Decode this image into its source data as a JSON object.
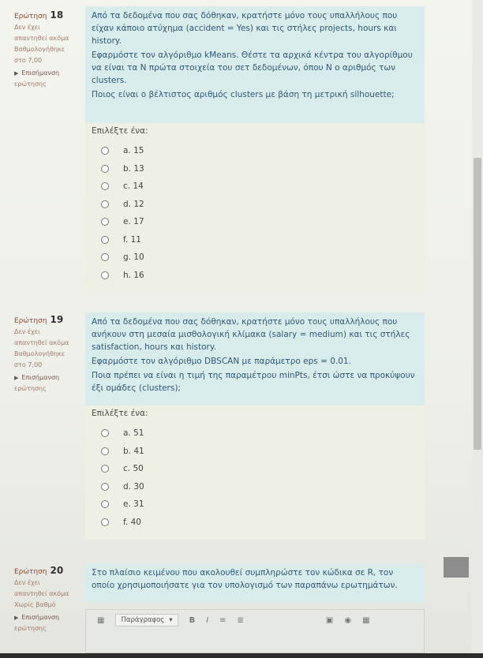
{
  "q18": {
    "label": "Ερώτηση",
    "number": "18",
    "status": "Δεν έχει",
    "status2": "απαντηθεί ακόμα",
    "grade_label": "Βαθμολογήθηκε",
    "grade_value": "στο 7,00",
    "flag": "Επισήμανση",
    "flag2": "ερώτησης",
    "text1": "Από τα δεδομένα που σας δόθηκαν, κρατήστε μόνο τους υπαλλήλους που είχαν κάποιο ατύχημα (accident = Yes) και τις στήλες projects, hours και history.",
    "text2": "Εφαρμόστε τον αλγόριθμο kMeans. Θέστε τα αρχικά κέντρα του αλγορίθμου να είναι τα N πρώτα στοιχεία του σετ δεδομένων, όπου N ο αριθμός των clusters.",
    "text3": "Ποιος είναι ο βέλτιστος αριθμός clusters με βάση τη μετρική silhouette;",
    "prompt": "Επιλέξτε ένα:",
    "options": [
      "a. 15",
      "b. 13",
      "c. 14",
      "d. 12",
      "e. 17",
      "f. 11",
      "g. 10",
      "h. 16"
    ]
  },
  "q19": {
    "label": "Ερώτηση",
    "number": "19",
    "status": "Δεν έχει",
    "status2": "απαντηθεί ακόμα",
    "grade_label": "Βαθμολογήθηκε",
    "grade_value": "στο 7,00",
    "flag": "Επισήμανση",
    "flag2": "ερώτησης",
    "text1": "Από τα δεδομένα που σας δόθηκαν, κρατήστε μόνο τους υπαλλήλους που ανήκουν στη μεσαία μισθολογική κλίμακα (salary = medium) και τις στήλες satisfaction, hours και history.",
    "text2": "Εφαρμόστε τον αλγόριθμο DBSCAN με παράμετρο eps = 0.01.",
    "text3": "Ποια πρέπει να είναι η τιμή της παραμέτρου minPts, έτσι ώστε να προκύψουν έξι ομάδες (clusters);",
    "prompt": "Επιλέξτε ένα:",
    "options": [
      "a. 51",
      "b. 41",
      "c. 50",
      "d. 30",
      "e. 31",
      "f. 40"
    ]
  },
  "q20": {
    "label": "Ερώτηση",
    "number": "20",
    "status": "Δεν έχει",
    "status2": "απαντηθεί ακόμα",
    "grade_label": "Χωρίς βαθμό",
    "flag": "Επισήμανση",
    "flag2": "ερώτησης",
    "text1": "Στο πλαίσιο κειμένου που ακολουθεί συμπληρώστε τον κώδικα σε R, τον οποίο χρησιμοποιήσατε για τον υπολογισμό των παραπάνω ερωτημάτων.",
    "paragraph_select": "Παράγραφος",
    "bold_label": "B",
    "italic_label": "I"
  }
}
